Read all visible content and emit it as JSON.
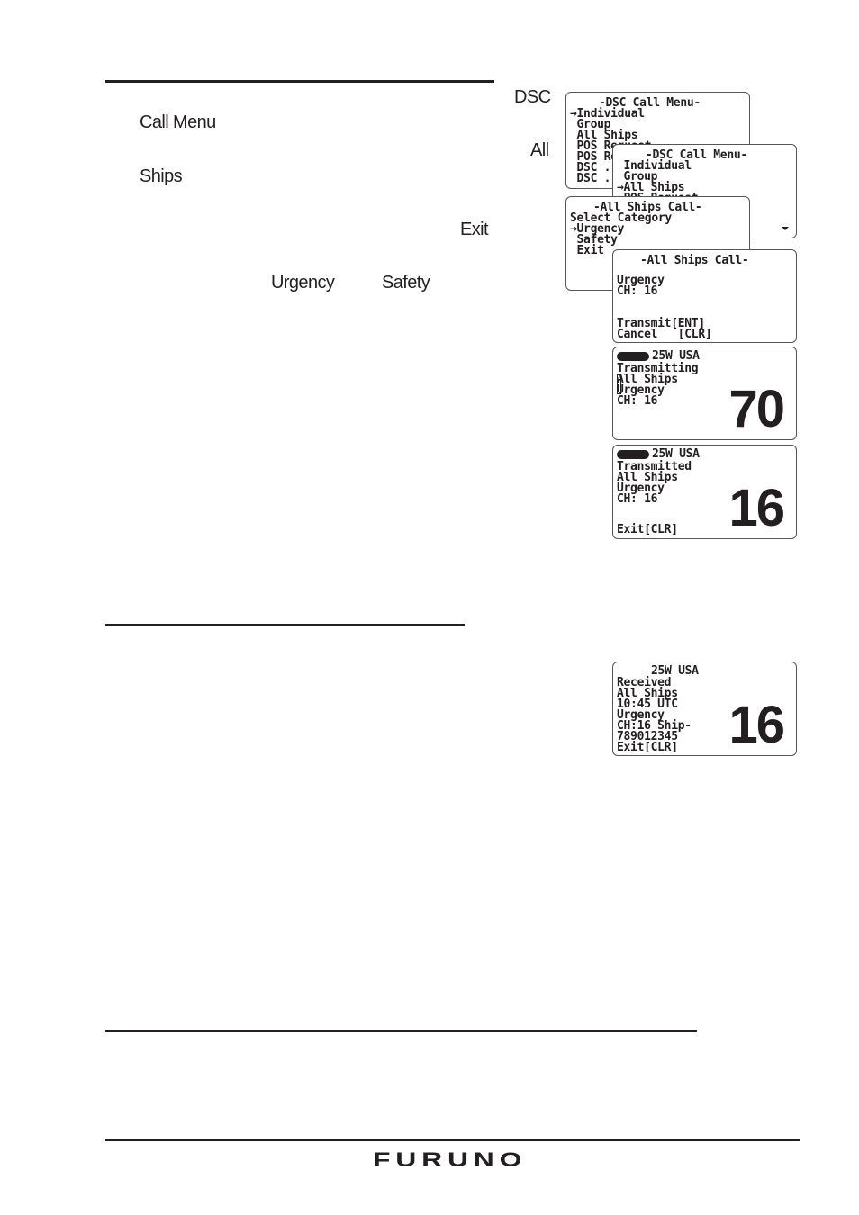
{
  "body_fragments": {
    "dsc": "DSC",
    "call_menu": "Call Menu",
    "all": "All",
    "ships": "Ships",
    "exit": "Exit",
    "urgency": "Urgency",
    "safety": "Safety"
  },
  "screens": {
    "dsc_menu_1": {
      "title": "-DSC Call Menu-",
      "lines": [
        "→Individual",
        " Group",
        " All Ships",
        " POS Request",
        " POS Report",
        " DSC ...",
        " DSC ..."
      ]
    },
    "dsc_menu_2": {
      "title": "-DSC Call Menu-",
      "lines": [
        " Individual",
        " Group",
        "→All Ships",
        " POS Request"
      ],
      "scroll_icon": "scroll-down-arrow"
    },
    "all_ships_select": {
      "title": "-All Ships Call-",
      "lines": [
        "Select Category",
        "→Urgency",
        " Safety",
        " Exit"
      ]
    },
    "all_ships_confirm": {
      "title": "-All Ships Call-",
      "lines": [
        "Urgency",
        "CH: 16",
        "",
        "",
        "Transmit[ENT]",
        "Cancel   [CLR]"
      ]
    },
    "transmitting": {
      "status": "25W USA",
      "lines": [
        "Transmitting",
        "All Ships",
        "Urgency",
        "CH: 16"
      ],
      "channel": "70"
    },
    "transmitted": {
      "status": "25W USA",
      "lines": [
        "Transmitted",
        "All Ships",
        "Urgency",
        "CH: 16"
      ],
      "footer": "Exit[CLR]",
      "channel": "16"
    },
    "received": {
      "status": "25W USA",
      "lines": [
        "Received",
        "All Ships",
        "10:45 UTC",
        "Urgency",
        "CH:16 Ship-",
        "789012345",
        "Exit[CLR]"
      ],
      "channel": "16"
    }
  },
  "footer": {
    "logo": "FURUNO"
  }
}
